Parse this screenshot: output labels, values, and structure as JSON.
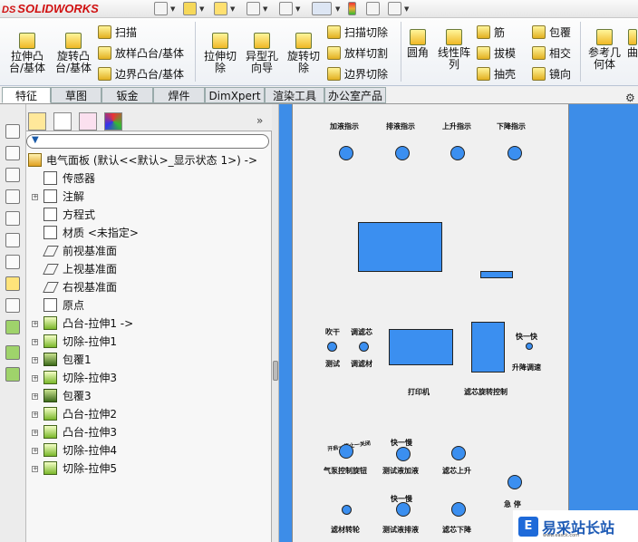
{
  "app": {
    "logo_ds": "DS",
    "logo_text": "SOLIDWORKS"
  },
  "ribbon": {
    "extrude_boss": "拉伸凸\n台/基体",
    "revolve_boss": "旋转凸\n台/基体",
    "sweep": "扫描",
    "loft_boss": "放样凸台/基体",
    "boundary_boss": "边界凸台/基体",
    "extrude_cut": "拉伸切\n除",
    "hole_wizard": "异型孔\n向导",
    "revolve_cut": "旋转切\n除",
    "swept_cut": "扫描切除",
    "lofted_cut": "放样切割",
    "boundary_cut": "边界切除",
    "fillet": "圆角",
    "linear_pattern": "线性阵\n列",
    "rib": "筋",
    "draft": "拔模",
    "shell": "抽壳",
    "wrap": "包覆",
    "intersect": "相交",
    "mirror": "镜向",
    "ref_geometry": "参考几\n何体",
    "curves": "曲"
  },
  "tabs": [
    "特征",
    "草图",
    "钣金",
    "焊件",
    "DimXpert",
    "渲染工具",
    "办公室产品"
  ],
  "tree": {
    "root": "电气面板 (默认<<默认>_显示状态 1>) ->",
    "items": [
      {
        "label": "传感器",
        "icon": "sensor-icon",
        "expandable": false
      },
      {
        "label": "注解",
        "icon": "annotation-icon",
        "expandable": true
      },
      {
        "label": "方程式",
        "icon": "equation-icon",
        "expandable": false
      },
      {
        "label": "材质 <未指定>",
        "icon": "material-icon",
        "expandable": false
      },
      {
        "label": "前视基准面",
        "icon": "plane-icon",
        "expandable": false
      },
      {
        "label": "上视基准面",
        "icon": "plane-icon",
        "expandable": false
      },
      {
        "label": "右视基准面",
        "icon": "plane-icon",
        "expandable": false
      },
      {
        "label": "原点",
        "icon": "origin-icon",
        "expandable": false
      },
      {
        "label": "凸台-拉伸1 ->",
        "icon": "extrude-icon",
        "expandable": true
      },
      {
        "label": "切除-拉伸1",
        "icon": "cut-icon",
        "expandable": true
      },
      {
        "label": "包覆1",
        "icon": "wrap-icon",
        "expandable": true
      },
      {
        "label": "切除-拉伸3",
        "icon": "cut-icon",
        "expandable": true
      },
      {
        "label": "包覆3",
        "icon": "wrap-icon",
        "expandable": true
      },
      {
        "label": "凸台-拉伸2",
        "icon": "extrude-icon",
        "expandable": true
      },
      {
        "label": "凸台-拉伸3",
        "icon": "extrude-icon",
        "expandable": true
      },
      {
        "label": "切除-拉伸4",
        "icon": "cut-icon",
        "expandable": true
      },
      {
        "label": "切除-拉伸5",
        "icon": "cut-icon",
        "expandable": true
      }
    ]
  },
  "panel": {
    "top_labels": [
      "加液指示",
      "排液指示",
      "上升指示",
      "下降指示"
    ],
    "blow_dry": "吹干",
    "adjust_filter": "调滤芯",
    "test": "测试",
    "adjust_material": "调滤材",
    "fast_slow": "快一快",
    "lift_adjust": "升降调速",
    "printer": "打印机",
    "filter_rotate": "滤芯旋转控制",
    "pump_label": "开启一停止一关闭",
    "pump_control": "气泵控制旋钮",
    "fast_slow_2": "快一慢",
    "test_liquid_add": "测试液加液",
    "filter_up": "滤芯上升",
    "emergency_stop": "急 停",
    "fast_slow_3": "快一慢",
    "material_rotate": "滤材转轮",
    "test_liquid_drain": "测试液排液",
    "filter_down": "滤芯下降"
  },
  "watermark": {
    "text": "易采站长站",
    "sub": "www.easck.com"
  },
  "colors": {
    "canvas_blue": "#3d8de8",
    "control_blue": "#3b8ff0",
    "panel_grey": "#f0f0f0"
  }
}
